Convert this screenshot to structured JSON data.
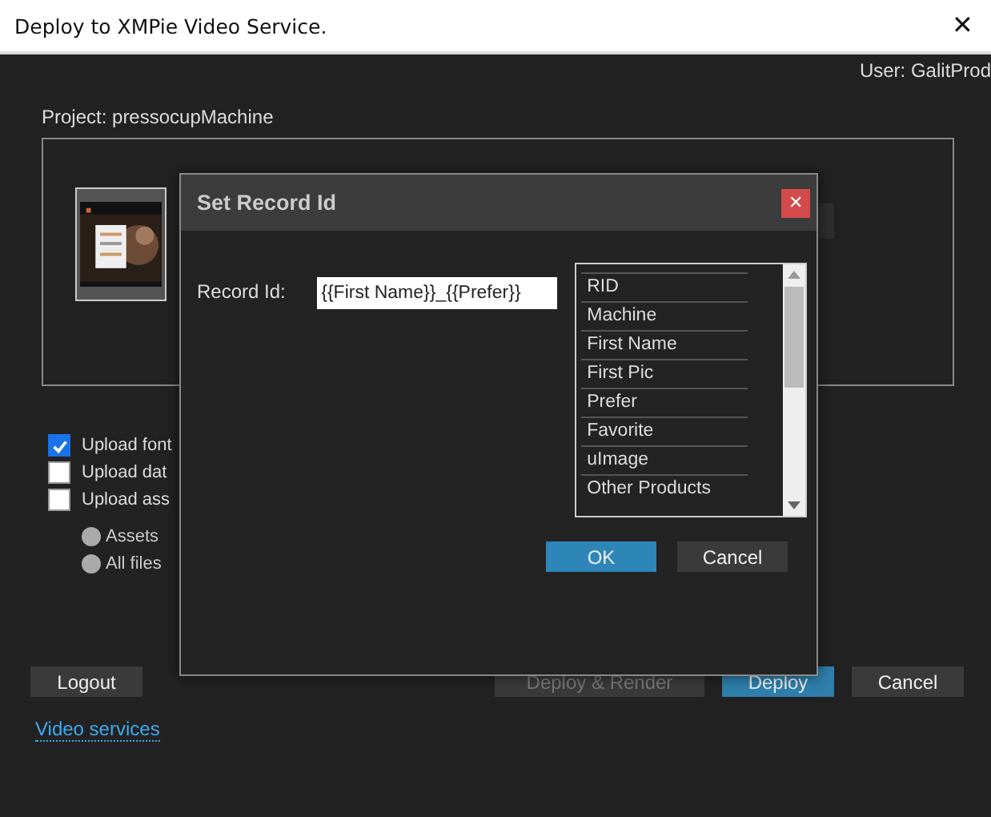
{
  "window": {
    "title": "Deploy to XMPie Video Service.",
    "close": "✕"
  },
  "user": "User: GalitProd",
  "project": {
    "label": "Project: pressocupMachine"
  },
  "options": [
    {
      "label": "Upload font",
      "checked": true
    },
    {
      "label": "Upload dat",
      "checked": false
    },
    {
      "label": "Upload ass",
      "checked": false
    }
  ],
  "radios": [
    {
      "label": "Assets",
      "selected": false
    },
    {
      "label": "All files",
      "selected": false
    }
  ],
  "buttons": [
    {
      "label": "Logout",
      "kind": "plain",
      "disabled": false
    },
    {
      "label": "Deploy & Render",
      "kind": "plain",
      "disabled": true
    },
    {
      "label": "Deploy",
      "kind": "primary",
      "disabled": false
    },
    {
      "label": "Cancel",
      "kind": "plain",
      "disabled": false
    }
  ],
  "link": "Video services",
  "dialog": {
    "title": "Set Record Id",
    "close": "✕",
    "field_label": "Record Id:",
    "field_value": "{{First Name}}_{{Prefer}}",
    "fields": [
      "RID",
      "Machine",
      "First Name",
      "First Pic",
      "Prefer",
      "Favorite",
      "uImage",
      "Other Products"
    ],
    "buttons": [
      {
        "label": "OK",
        "kind": "primary"
      },
      {
        "label": "Cancel",
        "kind": "plain"
      }
    ]
  }
}
